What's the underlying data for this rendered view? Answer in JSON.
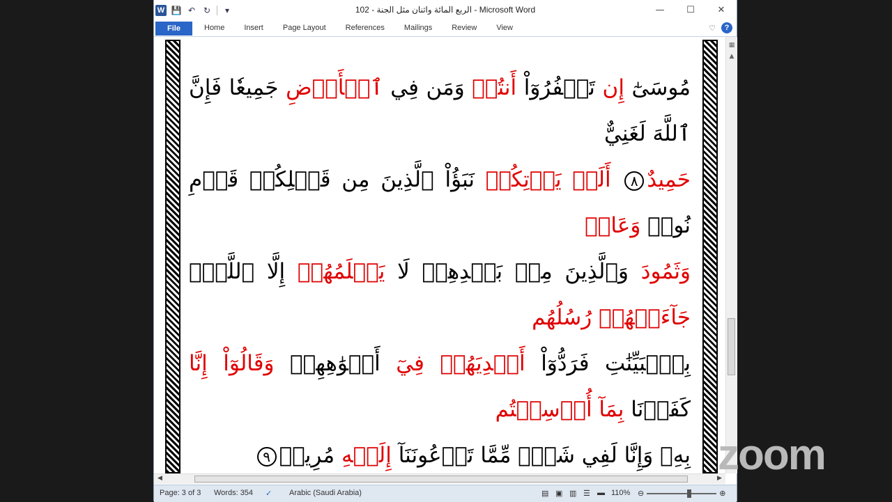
{
  "window": {
    "title": "الربع المائة واثنان مثل الجنة - 102 - Microsoft Word",
    "app_icon": "W"
  },
  "ribbon": {
    "file_label": "File",
    "tabs": [
      "Home",
      "Insert",
      "Page Layout",
      "References",
      "Mailings",
      "Review",
      "View"
    ],
    "help_label": "?"
  },
  "document": {
    "lines": [
      [
        {
          "t": "مُوسَىٰٓ ",
          "c": "black"
        },
        {
          "t": "إِن",
          "c": "red"
        },
        {
          "t": " تَكۡفُرُوٓاْ ",
          "c": "black"
        },
        {
          "t": "أَنتُمۡ",
          "c": "red"
        },
        {
          "t": " وَمَن فِي ",
          "c": "black"
        },
        {
          "t": "ٱلۡأَرۡضِ",
          "c": "red"
        },
        {
          "t": " جَمِيعٗا فَإِنَّ ٱللَّهَ لَغَنِيٌّ",
          "c": "black"
        }
      ],
      [
        {
          "t": "حَمِيدٌ",
          "c": "red"
        },
        {
          "t": " ٨ ",
          "c": "ayah"
        },
        {
          "t": " أَلَمۡ يَأۡتِكُمۡ",
          "c": "red"
        },
        {
          "t": " نَبَؤُاْ ٱلَّذِينَ مِن قَبۡلِكُمۡ قَوۡمِ نُوحٖ ",
          "c": "black"
        },
        {
          "t": "وَعَادٖ",
          "c": "red"
        }
      ],
      [
        {
          "t": "وَثَمُودَ",
          "c": "red"
        },
        {
          "t": " وَٱلَّذِينَ مِنۢ بَعۡدِهِمۡ لَا ",
          "c": "black"
        },
        {
          "t": "يَعۡلَمُهُمۡ",
          "c": "red"
        },
        {
          "t": " إِلَّا ٱللَّهُۚ ",
          "c": "black"
        },
        {
          "t": "جَآءَتۡهُمۡ",
          "c": "red"
        },
        {
          "t": " رُسُلُهُم",
          "c": "red"
        }
      ],
      [
        {
          "t": "بِٱلۡبَيِّنَٰتِ فَرَدُّوٓاْ ",
          "c": "black"
        },
        {
          "t": "أَيۡدِيَهُمۡ فِيٓ",
          "c": "red"
        },
        {
          "t": " أَفۡوَٰهِهِمۡ ",
          "c": "black"
        },
        {
          "t": "وَقَالُوٓاْ إِنَّا",
          "c": "red"
        },
        {
          "t": " كَفَرۡنَا ",
          "c": "black"
        },
        {
          "t": "بِمَآ أُرۡسِلۡتُم",
          "c": "red"
        }
      ],
      [
        {
          "t": "بِهِۦ وَإِنَّا لَفِي شَكّٖ مِّمَّا تَدۡعُونَنَآ ",
          "c": "black"
        },
        {
          "t": "إِلَيۡهِ",
          "c": "red"
        },
        {
          "t": " مُرِيبٖ",
          "c": "black"
        },
        {
          "t": "٩",
          "c": "ayah"
        }
      ]
    ]
  },
  "status_bar": {
    "page": "Page: 3 of 3",
    "words": "Words: 354",
    "language": "Arabic (Saudi Arabia)",
    "zoom": "110%"
  },
  "overlay": {
    "watermark": "zoom"
  },
  "colors": {
    "accent": "#2a65c8",
    "verse_red": "#e00000"
  }
}
